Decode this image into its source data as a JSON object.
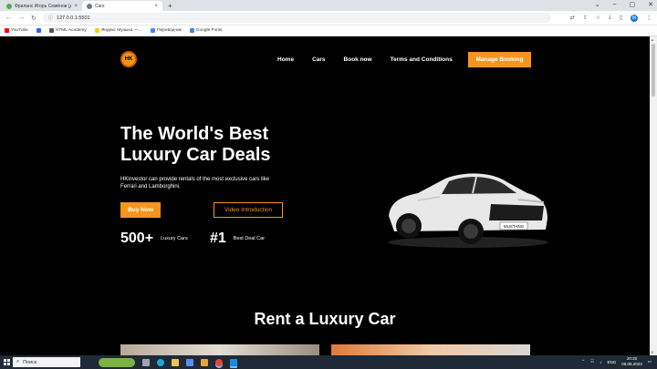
{
  "browser": {
    "tabs": [
      {
        "label": "Фриланс Игорь Семёнов (д…",
        "favicon_color": "#4caf50",
        "active": false
      },
      {
        "label": "Cars",
        "favicon_color": "#777777",
        "active": true
      }
    ],
    "new_tab": "+",
    "address": "127.0.0.1:5501",
    "bookmarks": [
      {
        "label": "YouTube",
        "icon_color": "#ff0000"
      },
      {
        "label": "",
        "icon_color": "#2962ff"
      },
      {
        "label": "HTML Academy",
        "icon_color": "#555555"
      },
      {
        "label": "Яндекс Музыка —…",
        "icon_color": "#ffcc00"
      },
      {
        "label": "Переводчик",
        "icon_color": "#4285f4"
      },
      {
        "label": "Google Fonts",
        "icon_color": "#4285f4"
      }
    ]
  },
  "site": {
    "logo_text": "HK",
    "nav": [
      "Home",
      "Cars",
      "Book now",
      "Terms and Conditions"
    ],
    "manage_booking": "Manage Booking",
    "hero": {
      "title_line1": "The World's Best",
      "title_line2": "Luxury Car Deals",
      "description": "HKinvestor can provide rentals of the most exclusive cars like Ferrari and Lamborghini.",
      "buy_now": "Buy Now",
      "video_intro": "Video Introduction"
    },
    "stats": [
      {
        "value": "500+",
        "label": "Luxury Cars"
      },
      {
        "value": "#1",
        "label": "Best Deal Car"
      }
    ],
    "car_plate": "MUSTANG",
    "section_title": "Rent a Luxury Car",
    "accent_color": "#f7941d"
  },
  "taskbar": {
    "search_placeholder": "Поиск",
    "lang": "ENG",
    "time": "20:20",
    "date": "08.08.2023"
  }
}
